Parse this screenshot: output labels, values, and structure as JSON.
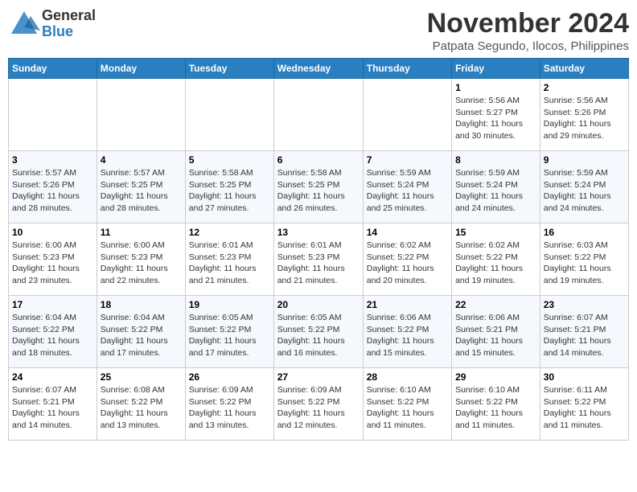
{
  "header": {
    "logo_general": "General",
    "logo_blue": "Blue",
    "month_title": "November 2024",
    "location": "Patpata Segundo, Ilocos, Philippines"
  },
  "calendar": {
    "days_of_week": [
      "Sunday",
      "Monday",
      "Tuesday",
      "Wednesday",
      "Thursday",
      "Friday",
      "Saturday"
    ],
    "weeks": [
      [
        {
          "day": "",
          "info": ""
        },
        {
          "day": "",
          "info": ""
        },
        {
          "day": "",
          "info": ""
        },
        {
          "day": "",
          "info": ""
        },
        {
          "day": "",
          "info": ""
        },
        {
          "day": "1",
          "info": "Sunrise: 5:56 AM\nSunset: 5:27 PM\nDaylight: 11 hours and 30 minutes."
        },
        {
          "day": "2",
          "info": "Sunrise: 5:56 AM\nSunset: 5:26 PM\nDaylight: 11 hours and 29 minutes."
        }
      ],
      [
        {
          "day": "3",
          "info": "Sunrise: 5:57 AM\nSunset: 5:26 PM\nDaylight: 11 hours and 28 minutes."
        },
        {
          "day": "4",
          "info": "Sunrise: 5:57 AM\nSunset: 5:25 PM\nDaylight: 11 hours and 28 minutes."
        },
        {
          "day": "5",
          "info": "Sunrise: 5:58 AM\nSunset: 5:25 PM\nDaylight: 11 hours and 27 minutes."
        },
        {
          "day": "6",
          "info": "Sunrise: 5:58 AM\nSunset: 5:25 PM\nDaylight: 11 hours and 26 minutes."
        },
        {
          "day": "7",
          "info": "Sunrise: 5:59 AM\nSunset: 5:24 PM\nDaylight: 11 hours and 25 minutes."
        },
        {
          "day": "8",
          "info": "Sunrise: 5:59 AM\nSunset: 5:24 PM\nDaylight: 11 hours and 24 minutes."
        },
        {
          "day": "9",
          "info": "Sunrise: 5:59 AM\nSunset: 5:24 PM\nDaylight: 11 hours and 24 minutes."
        }
      ],
      [
        {
          "day": "10",
          "info": "Sunrise: 6:00 AM\nSunset: 5:23 PM\nDaylight: 11 hours and 23 minutes."
        },
        {
          "day": "11",
          "info": "Sunrise: 6:00 AM\nSunset: 5:23 PM\nDaylight: 11 hours and 22 minutes."
        },
        {
          "day": "12",
          "info": "Sunrise: 6:01 AM\nSunset: 5:23 PM\nDaylight: 11 hours and 21 minutes."
        },
        {
          "day": "13",
          "info": "Sunrise: 6:01 AM\nSunset: 5:23 PM\nDaylight: 11 hours and 21 minutes."
        },
        {
          "day": "14",
          "info": "Sunrise: 6:02 AM\nSunset: 5:22 PM\nDaylight: 11 hours and 20 minutes."
        },
        {
          "day": "15",
          "info": "Sunrise: 6:02 AM\nSunset: 5:22 PM\nDaylight: 11 hours and 19 minutes."
        },
        {
          "day": "16",
          "info": "Sunrise: 6:03 AM\nSunset: 5:22 PM\nDaylight: 11 hours and 19 minutes."
        }
      ],
      [
        {
          "day": "17",
          "info": "Sunrise: 6:04 AM\nSunset: 5:22 PM\nDaylight: 11 hours and 18 minutes."
        },
        {
          "day": "18",
          "info": "Sunrise: 6:04 AM\nSunset: 5:22 PM\nDaylight: 11 hours and 17 minutes."
        },
        {
          "day": "19",
          "info": "Sunrise: 6:05 AM\nSunset: 5:22 PM\nDaylight: 11 hours and 17 minutes."
        },
        {
          "day": "20",
          "info": "Sunrise: 6:05 AM\nSunset: 5:22 PM\nDaylight: 11 hours and 16 minutes."
        },
        {
          "day": "21",
          "info": "Sunrise: 6:06 AM\nSunset: 5:22 PM\nDaylight: 11 hours and 15 minutes."
        },
        {
          "day": "22",
          "info": "Sunrise: 6:06 AM\nSunset: 5:21 PM\nDaylight: 11 hours and 15 minutes."
        },
        {
          "day": "23",
          "info": "Sunrise: 6:07 AM\nSunset: 5:21 PM\nDaylight: 11 hours and 14 minutes."
        }
      ],
      [
        {
          "day": "24",
          "info": "Sunrise: 6:07 AM\nSunset: 5:21 PM\nDaylight: 11 hours and 14 minutes."
        },
        {
          "day": "25",
          "info": "Sunrise: 6:08 AM\nSunset: 5:22 PM\nDaylight: 11 hours and 13 minutes."
        },
        {
          "day": "26",
          "info": "Sunrise: 6:09 AM\nSunset: 5:22 PM\nDaylight: 11 hours and 13 minutes."
        },
        {
          "day": "27",
          "info": "Sunrise: 6:09 AM\nSunset: 5:22 PM\nDaylight: 11 hours and 12 minutes."
        },
        {
          "day": "28",
          "info": "Sunrise: 6:10 AM\nSunset: 5:22 PM\nDaylight: 11 hours and 11 minutes."
        },
        {
          "day": "29",
          "info": "Sunrise: 6:10 AM\nSunset: 5:22 PM\nDaylight: 11 hours and 11 minutes."
        },
        {
          "day": "30",
          "info": "Sunrise: 6:11 AM\nSunset: 5:22 PM\nDaylight: 11 hours and 11 minutes."
        }
      ]
    ]
  }
}
